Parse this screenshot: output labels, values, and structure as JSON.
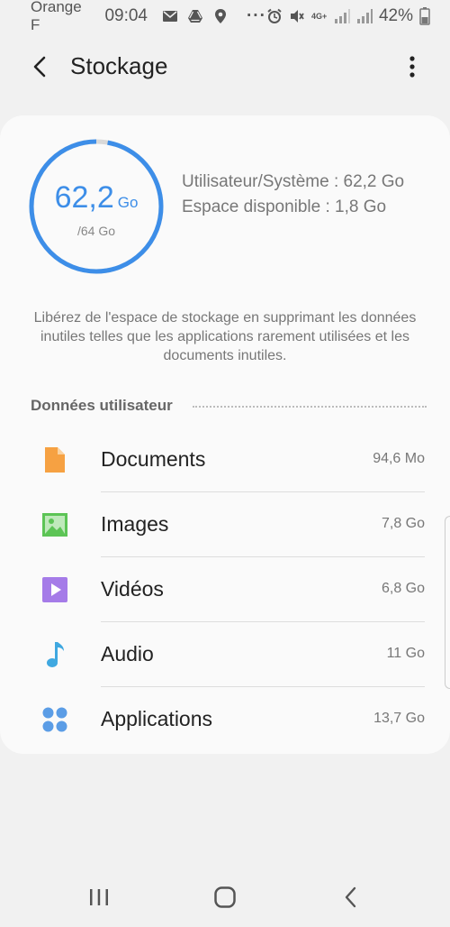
{
  "status_bar": {
    "carrier": "Orange F",
    "time": "09:04",
    "more": "···",
    "battery": "42%",
    "network": "4G+"
  },
  "header": {
    "title": "Stockage"
  },
  "storage": {
    "used_value": "62,2",
    "used_unit": "Go",
    "total": "/64 Go",
    "used_fraction": 0.972,
    "ring_color": "#3d8ee8",
    "user_system": "Utilisateur/Système : 62,2 Go",
    "available": "Espace disponible : 1,8 Go"
  },
  "hint": "Libérez de l'espace de stockage en supprimant les données inutiles telles que les applications rarement utilisées et les documents inutiles.",
  "section": {
    "title": "Données utilisateur"
  },
  "items": [
    {
      "label": "Documents",
      "size": "94,6 Mo",
      "icon": "document-icon",
      "color": "#f6a142"
    },
    {
      "label": "Images",
      "size": "7,8 Go",
      "icon": "image-icon",
      "color": "#5cc455"
    },
    {
      "label": "Vidéos",
      "size": "6,8 Go",
      "icon": "video-icon",
      "color": "#a57be8"
    },
    {
      "label": "Audio",
      "size": "11 Go",
      "icon": "music-note-icon",
      "color": "#3fa8e0"
    },
    {
      "label": "Applications",
      "size": "13,7 Go",
      "icon": "apps-icon",
      "color": "#5b9de6"
    }
  ]
}
